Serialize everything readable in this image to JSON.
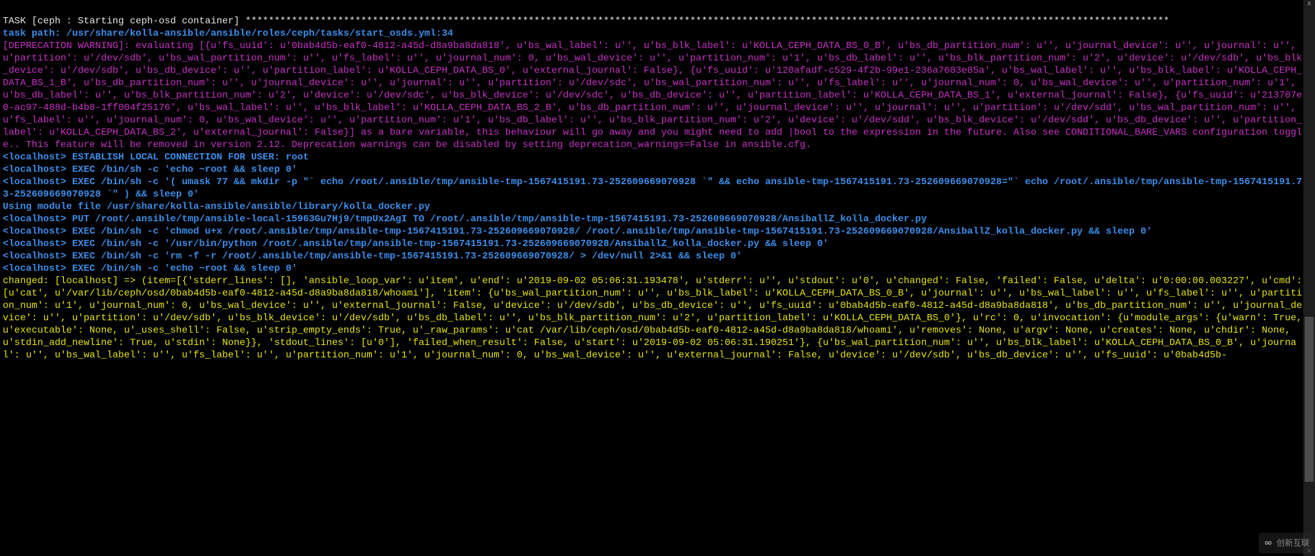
{
  "task_header": "TASK [ceph : Starting ceph-osd container] ****************************************************************************************************************************************************************",
  "task_path": "task path: /usr/share/kolla-ansible/ansible/roles/ceph/tasks/start_osds.yml:34",
  "deprecation": "[DEPRECATION WARNING]: evaluating [{u'fs_uuid': u'0bab4d5b-eaf0-4812-a45d-d8a9ba8da818', u'bs_wal_label': u'', u'bs_blk_label': u'KOLLA_CEPH_DATA_BS_0_B', u'bs_db_partition_num': u'', u'journal_device': u'', u'journal': u'', u'partition': u'/dev/sdb', u'bs_wal_partition_num': u'', u'fs_label': u'', u'journal_num': 0, u'bs_wal_device': u'', u'partition_num': u'1', u'bs_db_label': u'', u'bs_blk_partition_num': u'2', u'device': u'/dev/sdb', u'bs_blk_device': u'/dev/sdb', u'bs_db_device': u'', u'partition_label': u'KOLLA_CEPH_DATA_BS_0', u'external_journal': False}, {u'fs_uuid': u'120afadf-c529-4f2b-99e1-236a7603e85a', u'bs_wal_label': u'', u'bs_blk_label': u'KOLLA_CEPH_DATA_BS_1_B', u'bs_db_partition_num': u'', u'journal_device': u'', u'journal': u'', u'partition': u'/dev/sdc', u'bs_wal_partition_num': u'', u'fs_label': u'', u'journal_num': 0, u'bs_wal_device': u'', u'partition_num': u'1', u'bs_db_label': u'', u'bs_blk_partition_num': u'2', u'device': u'/dev/sdc', u'bs_blk_device': u'/dev/sdc', u'bs_db_device': u'', u'partition_label': u'KOLLA_CEPH_DATA_BS_1', u'external_journal': False}, {u'fs_uuid': u'213707e0-ac97-488d-b4b8-1ff004f25176', u'bs_wal_label': u'', u'bs_blk_label': u'KOLLA_CEPH_DATA_BS_2_B', u'bs_db_partition_num': u'', u'journal_device': u'', u'journal': u'', u'partition': u'/dev/sdd', u'bs_wal_partition_num': u'', u'fs_label': u'', u'journal_num': 0, u'bs_wal_device': u'', u'partition_num': u'1', u'bs_db_label': u'', u'bs_blk_partition_num': u'2', u'device': u'/dev/sdd', u'bs_blk_device': u'/dev/sdd', u'bs_db_device': u'', u'partition_label': u'KOLLA_CEPH_DATA_BS_2', u'external_journal': False}] as a bare variable, this behaviour will go away and you might need to add |bool to the expression in the future. Also see CONDITIONAL_BARE_VARS configuration toggle.. This feature will be removed in version 2.12. Deprecation warnings can be disabled by setting deprecation_warnings=False in ansible.cfg.",
  "exec_lines": [
    "<localhost> ESTABLISH LOCAL CONNECTION FOR USER: root",
    "<localhost> EXEC /bin/sh -c 'echo ~root && sleep 0'",
    "<localhost> EXEC /bin/sh -c '( umask 77 && mkdir -p \"` echo /root/.ansible/tmp/ansible-tmp-1567415191.73-252609669070928 `\" && echo ansible-tmp-1567415191.73-252609669070928=\"` echo /root/.ansible/tmp/ansible-tmp-1567415191.73-252609669070928 `\" ) && sleep 0'"
  ],
  "module_line": "Using module file /usr/share/kolla-ansible/ansible/library/kolla_docker.py",
  "exec_lines2": [
    "<localhost> PUT /root/.ansible/tmp/ansible-local-15963Gu7Hj9/tmpUx2AgI TO /root/.ansible/tmp/ansible-tmp-1567415191.73-252609669070928/AnsiballZ_kolla_docker.py",
    "<localhost> EXEC /bin/sh -c 'chmod u+x /root/.ansible/tmp/ansible-tmp-1567415191.73-252609669070928/ /root/.ansible/tmp/ansible-tmp-1567415191.73-252609669070928/AnsiballZ_kolla_docker.py && sleep 0'",
    "<localhost> EXEC /bin/sh -c '/usr/bin/python /root/.ansible/tmp/ansible-tmp-1567415191.73-252609669070928/AnsiballZ_kolla_docker.py && sleep 0'",
    "<localhost> EXEC /bin/sh -c 'rm -f -r /root/.ansible/tmp/ansible-tmp-1567415191.73-252609669070928/ > /dev/null 2>&1 && sleep 0'",
    "<localhost> EXEC /bin/sh -c 'echo ~root && sleep 0'"
  ],
  "changed": "changed: [localhost] => (item=[{'stderr_lines': [], 'ansible_loop_var': u'item', u'end': u'2019-09-02 05:06:31.193478', u'stderr': u'', u'stdout': u'0', u'changed': False, 'failed': False, u'delta': u'0:00:00.003227', u'cmd': [u'cat', u'/var/lib/ceph/osd/0bab4d5b-eaf0-4812-a45d-d8a9ba8da818/whoami'], 'item': {u'bs_wal_partition_num': u'', u'bs_blk_label': u'KOLLA_CEPH_DATA_BS_0_B', u'journal': u'', u'bs_wal_label': u'', u'fs_label': u'', u'partition_num': u'1', u'journal_num': 0, u'bs_wal_device': u'', u'external_journal': False, u'device': u'/dev/sdb', u'bs_db_device': u'', u'fs_uuid': u'0bab4d5b-eaf0-4812-a45d-d8a9ba8da818', u'bs_db_partition_num': u'', u'journal_device': u'', u'partition': u'/dev/sdb', u'bs_blk_device': u'/dev/sdb', u'bs_db_label': u'', u'bs_blk_partition_num': u'2', u'partition_label': u'KOLLA_CEPH_DATA_BS_0'}, u'rc': 0, u'invocation': {u'module_args': {u'warn': True, u'executable': None, u'_uses_shell': False, u'strip_empty_ends': True, u'_raw_params': u'cat /var/lib/ceph/osd/0bab4d5b-eaf0-4812-a45d-d8a9ba8da818/whoami', u'removes': None, u'argv': None, u'creates': None, u'chdir': None, u'stdin_add_newline': True, u'stdin': None}}, 'stdout_lines': [u'0'], 'failed_when_result': False, u'start': u'2019-09-02 05:06:31.190251'}, {u'bs_wal_partition_num': u'', u'bs_blk_label': u'KOLLA_CEPH_DATA_BS_0_B', u'journal': u'', u'bs_wal_label': u'', u'fs_label': u'', u'partition_num': u'1', u'journal_num': 0, u'bs_wal_device': u'', u'external_journal': False, u'device': u'/dev/sdb', u'bs_db_device': u'', u'fs_uuid': u'0bab4d5b-",
  "watermark_text": "创新互联"
}
